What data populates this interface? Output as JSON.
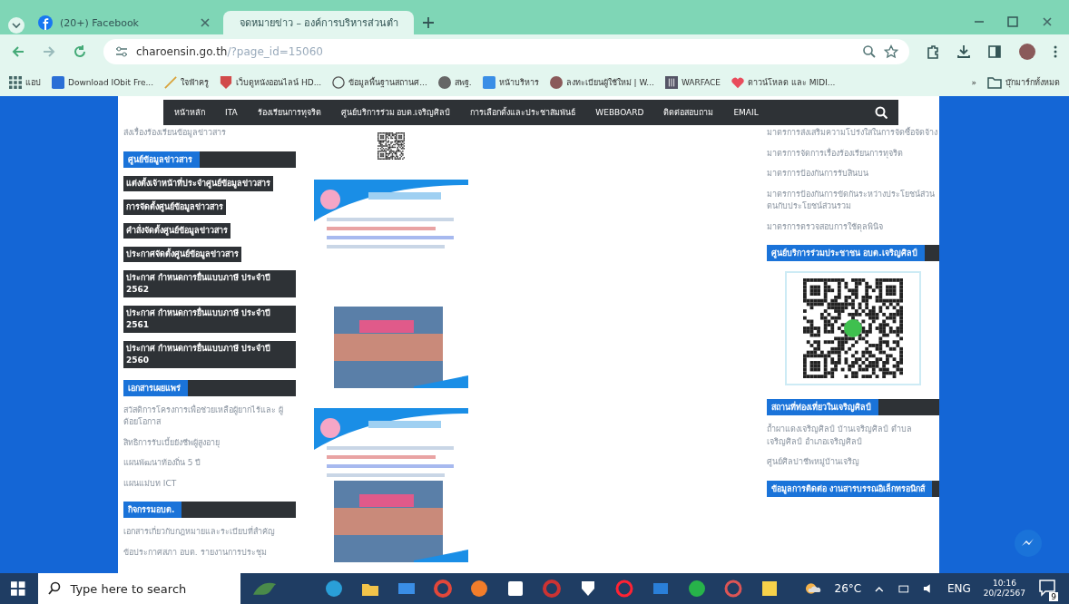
{
  "browser": {
    "tabs": [
      {
        "title": "(20+) Facebook",
        "selected": false
      },
      {
        "title": "จดหมายข่าว – องค์การบริหารส่วนตำ",
        "selected": true
      }
    ],
    "url": {
      "host": "charoensin.go.th",
      "path": "/?page_id=15060"
    },
    "bookmarks": [
      "แอป",
      "Download IObit Fre...",
      "ใจฟ้าครู",
      "เว็บดูหนังออนไลน์ HD...",
      "ข้อมูลพื้นฐานสถานศ...",
      "สพฐ.",
      "หน้าบริหาร",
      "ลงทะเบียนผู้ใช้ใหม่ | W...",
      "WARFACE",
      "ดาวน์โหลด และ MIDI..."
    ],
    "more": "»",
    "all_bookmarks": "บุ๊กมาร์กทั้งหมด"
  },
  "site": {
    "nav": [
      "หน้าหลัก",
      "ITA",
      "ร้องเรียนการทุจริต",
      "ศูนย์บริการร่วม อบต.เจริญศิลป์",
      "การเลือกตั้งและประชาสัมพันธ์",
      "WEBBOARD",
      "ติดต่อสอบถาม",
      "EMAIL"
    ],
    "left_top": [
      "ส่งเรื่องร้องเรียนข้อมูลข่าวสาร"
    ],
    "left": [
      {
        "header": "ศูนย์ข้อมูลข่าวสาร",
        "links": [
          {
            "text": "แต่งตั้งเจ้าหน้าที่ประจำศูนย์ข้อมูลข่าวสาร",
            "kind": "highlight"
          },
          {
            "text": "การจัดตั้งศูนย์ข้อมูลข่าวสาร",
            "kind": "highlight"
          },
          {
            "text": "คำสั่งจัดตั้งศูนย์ข้อมูลข่าวสาร",
            "kind": "highlight"
          },
          {
            "text": "ประกาศจัดตั้งศูนย์ข้อมูลข่าวสาร",
            "kind": "highlight"
          },
          {
            "text": "ประกาศ กำหนดการยื่นแบบภาษี ประจำปี 2562",
            "kind": "highlight"
          },
          {
            "text": "ประกาศ กำหนดการยื่นแบบภาษี ประจำปี 2561",
            "kind": "highlight"
          },
          {
            "text": "ประกาศ กำหนดการยื่นแบบภาษี ประจำปี 2560",
            "kind": "highlight"
          }
        ]
      },
      {
        "header": "เอกสารเผยแพร่",
        "links": [
          {
            "text": "สวัสดิการโครงการเพื่อช่วยเหลือผู้ยากไร้และ ผู้ด้อยโอกาส",
            "kind": "plain"
          },
          {
            "text": "สิทธิการรับเบี้ยยังชีพผู้สูงอายุ",
            "kind": "plain"
          },
          {
            "text": "แผนพัฒนาท้องถิ่น 5 ปี",
            "kind": "plain"
          },
          {
            "text": "แผนแม่บท ICT",
            "kind": "plain"
          }
        ]
      },
      {
        "header": "กิจกรรมอบต.",
        "links": [
          {
            "text": "เอกสารเกี่ยวกับกฎหมายและระเบียบที่สำคัญ",
            "kind": "plain"
          },
          {
            "text": "ข้อประกาศสภา อบต. รายงานการประชุม",
            "kind": "plain"
          }
        ]
      }
    ],
    "right_links": [
      "มาตรการส่งเสริมความโปร่งใสในการจัดซื้อจัดจ้าง",
      "มาตรการจัดการเรื่องร้องเรียนการทุจริต",
      "มาตรการป้องกันการรับสินบน",
      "มาตรการป้องกันการขัดกันระหว่างประโยชน์ส่วนตนกับประโยชน์ส่วนรวม",
      "มาตรการตรวจสอบการใช้ดุลพินิจ"
    ],
    "right": [
      {
        "header": "ศูนย์บริการร่วมประชาชน อบต.เจริญศิลป์",
        "qr": true
      },
      {
        "header": "สถานที่ท่องเที่ยวในเจริญศิลป์",
        "links": [
          "ถ้ำผาแดงเจริญศิลป์ บ้านเจริญศิลป์ ตำบลเจริญศิลป์ อำเภอเจริญศิลป์",
          "ศูนย์ศิลปาชีพหมู่บ้านเจริญ"
        ]
      },
      {
        "header": "ข้อมูลการติดต่อ งานสารบรรณอิเล็กทรอนิกส์"
      }
    ]
  },
  "taskbar": {
    "search_placeholder": "Type here to search",
    "weather": "26°C",
    "language": "ENG",
    "time": "10:16",
    "date": "20/2/2567",
    "notifications": "9"
  }
}
